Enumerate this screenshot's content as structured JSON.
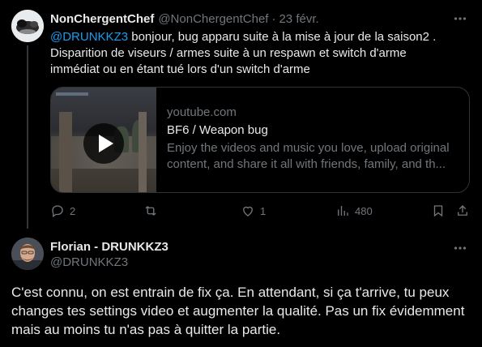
{
  "tweet1": {
    "display_name": "NonChergentChef",
    "handle": "@NonChergentChef",
    "separator": "·",
    "timestamp": "23 févr.",
    "mention": "@DRUNKKZ3",
    "text": " bonjour, bug apparu suite à la mise à jour de la saison2 . Disparition de viseurs / armes suite à un respawn et switch d'arme immédiat ou en étant tué lors d'un switch d'arme",
    "card": {
      "domain": "youtube.com",
      "title": "BF6 / Weapon bug",
      "description": "Enjoy the videos and music you love, upload original content, and share it all with friends, family, and th..."
    },
    "actions": {
      "replies": "2",
      "reposts": "",
      "likes": "1",
      "views": "480"
    },
    "more_icon": "ellipsis-icon"
  },
  "tweet2": {
    "display_name": "Florian - DRUNKKZ3",
    "handle": "@DRUNKKZ3",
    "text": "C'est connu, on est entrain de fix ça. En attendant, si ça t'arrive, tu peux changes tes settings video et augmenter la qualité. Pas un fix évidemment mais au moins tu n'as pas à quitter la partie.",
    "more_icon": "ellipsis-icon"
  },
  "colors": {
    "background": "#000000",
    "primary_text": "#e7e9ea",
    "secondary_text": "#71767b",
    "accent": "#1d9bf0",
    "border": "#2f3336"
  }
}
